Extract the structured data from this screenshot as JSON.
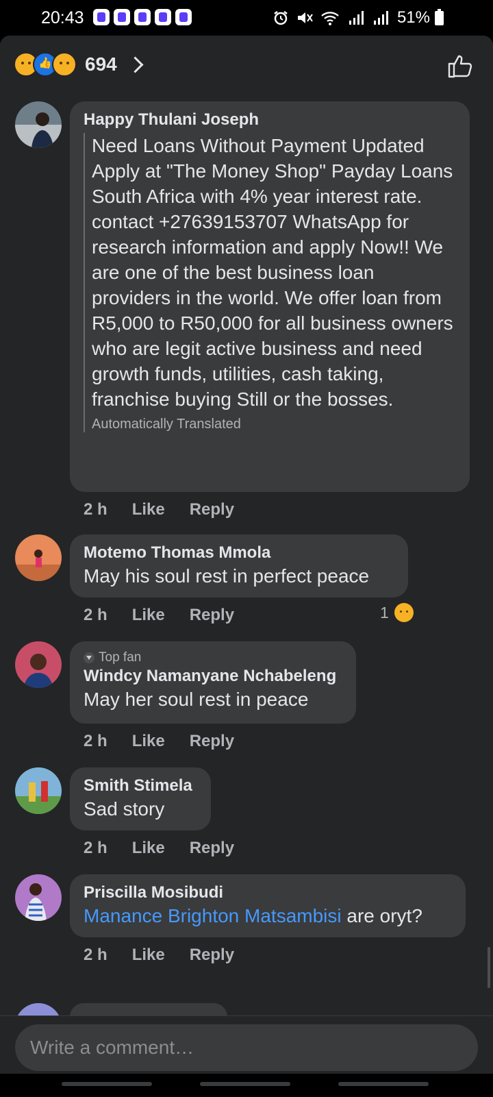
{
  "status_bar": {
    "time": "20:43",
    "app_icons": [
      "p-app-icon",
      "p-app-icon",
      "p-app-icon",
      "p-app-icon",
      "p-app-icon"
    ],
    "battery": "51%"
  },
  "reactions": {
    "count": "694",
    "emojis": [
      "sad",
      "like",
      "wow"
    ]
  },
  "comments": [
    {
      "author": "Happy Thulani Joseph",
      "text": "Need Loans Without Payment Updated Apply at \"The Money Shop\" Payday Loans South Africa with 4% year interest rate.\ncontact +27639153707 WhatsApp for research information and apply Now!! We are one of the best business loan providers in the world. We offer loan from R5,000 to R50,000 for all business owners who are legit active business and need growth funds, utilities, cash taking, franchise buying Still or the bosses.",
      "translated_label": "Automatically Translated",
      "time": "2 h",
      "like": "Like",
      "reply": "Reply"
    },
    {
      "author": "Motemo Thomas Mmola",
      "text": "May his soul rest in perfect peace",
      "time": "2 h",
      "like": "Like",
      "reply": "Reply",
      "reaction_count": "1"
    },
    {
      "badge": "Top fan",
      "author": "Windcy Namanyane Nchabeleng",
      "text": "May her soul rest in peace",
      "time": "2 h",
      "like": "Like",
      "reply": "Reply"
    },
    {
      "author": "Smith Stimela",
      "text": "Sad story",
      "time": "2 h",
      "like": "Like",
      "reply": "Reply"
    },
    {
      "author": "Priscilla Mosibudi",
      "mention": "Manance Brighton Matsambisi",
      "text": " are oryt?",
      "time": "2 h",
      "like": "Like",
      "reply": "Reply"
    }
  ],
  "composer": {
    "placeholder": "Write a comment…"
  },
  "colors": {
    "sheet_bg": "#242526",
    "bubble_bg": "#3a3b3c",
    "link": "#4599ff",
    "secondary_text": "#b0b3b8"
  }
}
